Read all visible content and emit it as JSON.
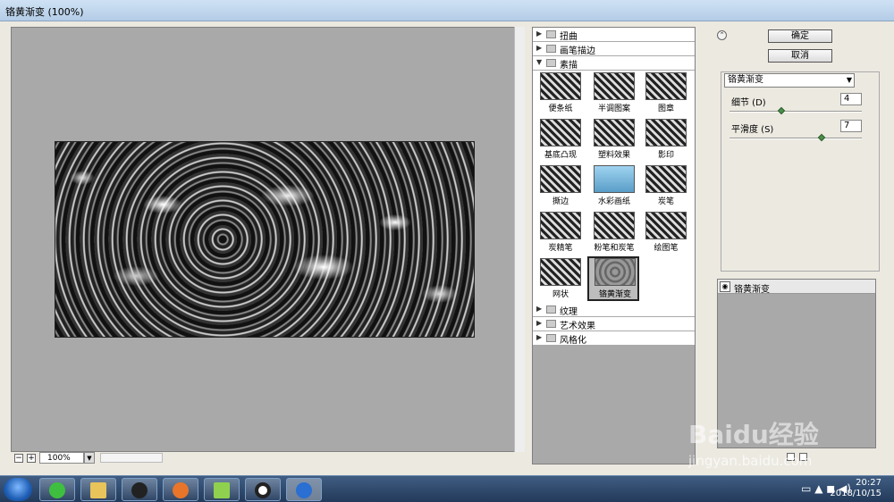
{
  "window": {
    "title": "铬黄渐变 (100%)"
  },
  "preview": {
    "zoom": "100%"
  },
  "gallery": {
    "categories_top": [
      "扭曲",
      "画笔描边"
    ],
    "expanded_category": "素描",
    "filters": [
      "便条纸",
      "半调图案",
      "图章",
      "基底凸现",
      "塑料效果",
      "影印",
      "撕边",
      "水彩画纸",
      "炭笔",
      "炭精笔",
      "粉笔和炭笔",
      "绘图笔",
      "网状",
      "铬黄渐变"
    ],
    "selected_filter": "铬黄渐变",
    "categories_bottom": [
      "纹理",
      "艺术效果",
      "风格化"
    ]
  },
  "buttons": {
    "ok": "确定",
    "cancel": "取消"
  },
  "settings": {
    "filter_select": "铬黄渐变",
    "params": [
      {
        "label": "细节 (D)",
        "value": "4",
        "slider_fraction": 0.4
      },
      {
        "label": "平滑度 (S)",
        "value": "7",
        "slider_fraction": 0.7
      }
    ]
  },
  "layers": {
    "active_layer": "铬黄渐变"
  },
  "taskbar": {
    "time": "20:27",
    "date": "2018/10/15"
  },
  "watermark": {
    "logo": "Baidu经验",
    "url": "jingyan.baidu.com"
  }
}
